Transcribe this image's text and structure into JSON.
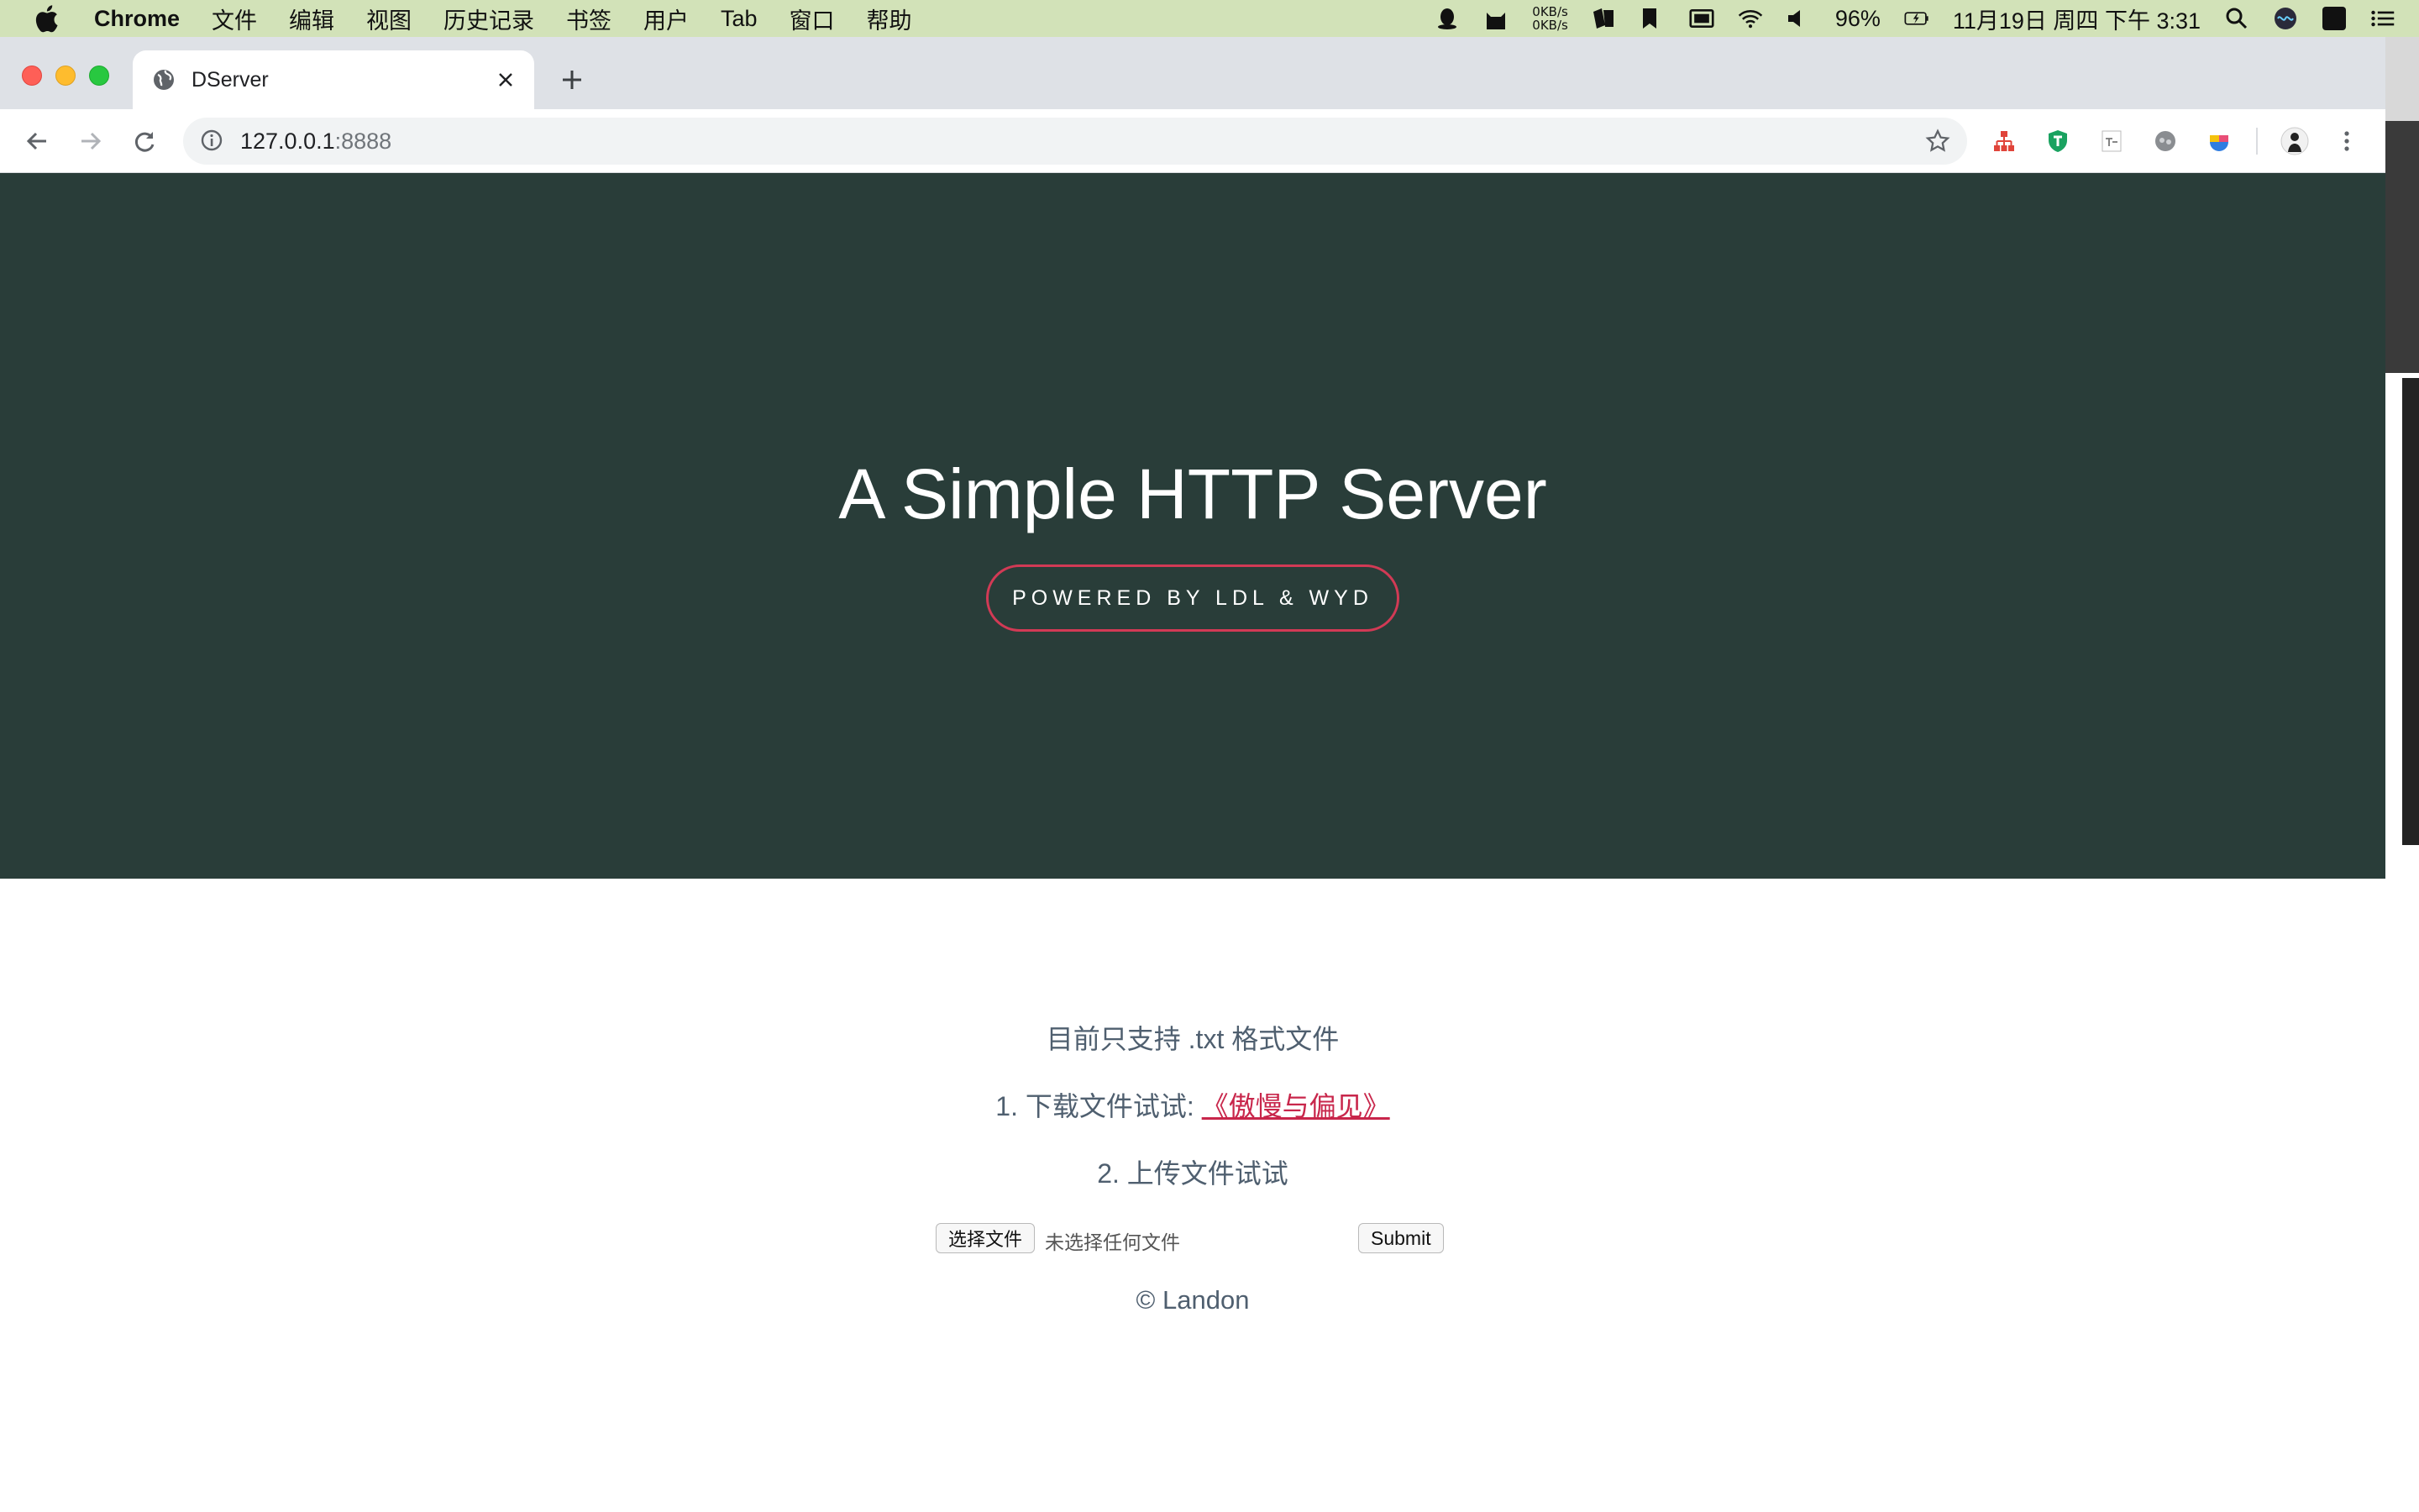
{
  "menubar": {
    "app_name": "Chrome",
    "items": [
      "文件",
      "编辑",
      "视图",
      "历史记录",
      "书签",
      "用户",
      "Tab",
      "窗口",
      "帮助"
    ],
    "net_up": "0KB/s",
    "net_down": "0KB/s",
    "battery": "96%",
    "datetime": "11月19日 周四 下午 3:31",
    "input_method": "A"
  },
  "browser": {
    "tab_title": "DServer",
    "url_host": "127.0.0.1",
    "url_port": ":8888"
  },
  "page": {
    "hero_title": "A Simple HTTP Server",
    "hero_badge": "POWERED BY LDL & WYD",
    "notice": "目前只支持 .txt 格式文件",
    "step1_prefix": "1. 下载文件试试: ",
    "step1_link": "《傲慢与偏见》",
    "step2": "2. 上传文件试试",
    "choose_file_label": "选择文件",
    "no_file_label": "未选择任何文件",
    "submit_label": "Submit",
    "footer": "© Landon"
  },
  "colors": {
    "hero_bg": "#293d39",
    "accent": "#d23a55",
    "link": "#c8264b",
    "text": "#4f5f6f"
  }
}
